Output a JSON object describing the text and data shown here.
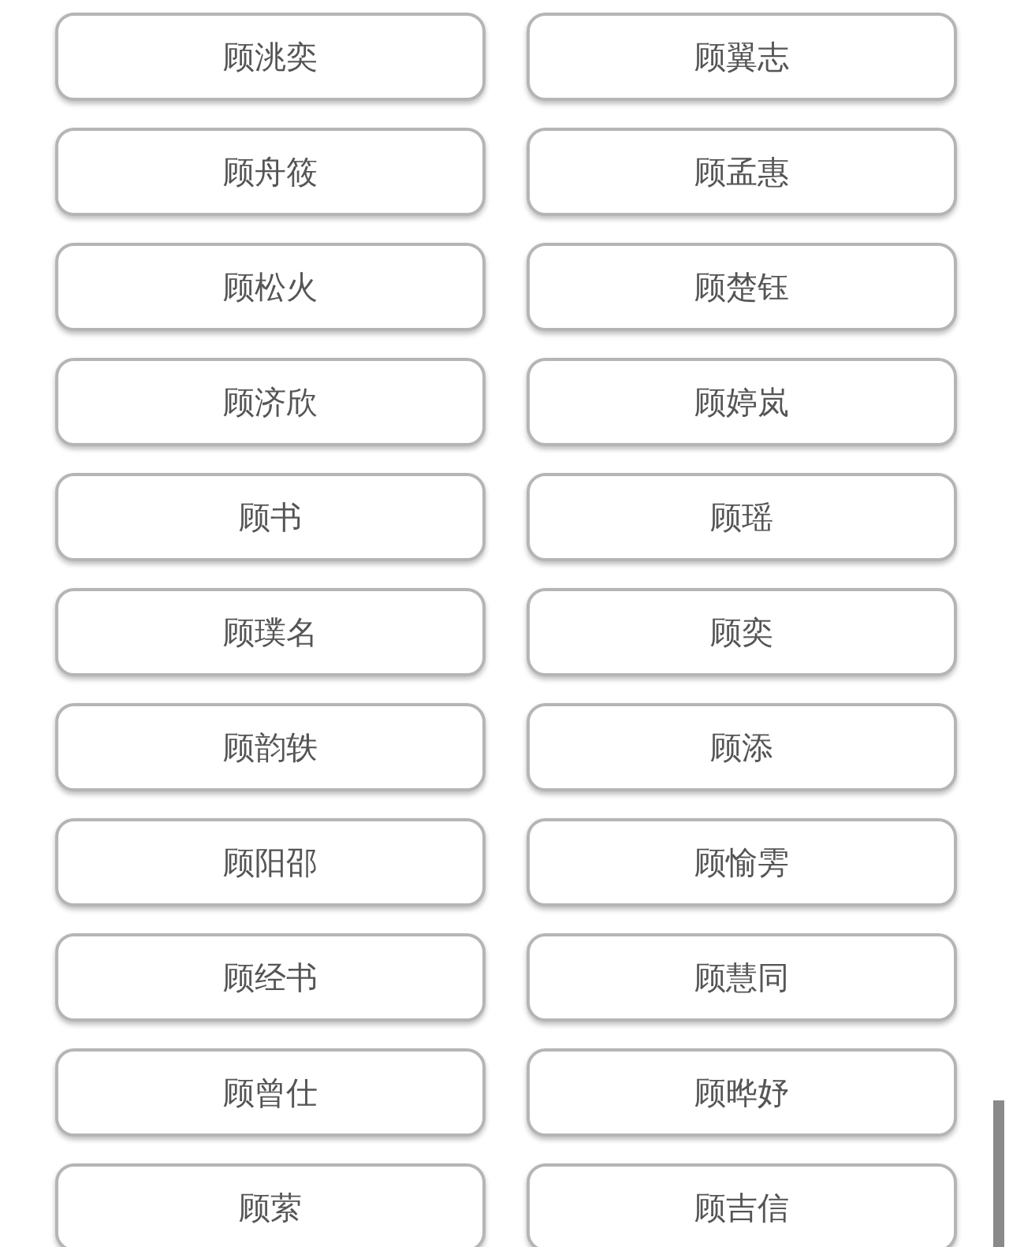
{
  "names": [
    {
      "label": "顾洮奕"
    },
    {
      "label": "顾翼志"
    },
    {
      "label": "顾舟筱"
    },
    {
      "label": "顾孟惠"
    },
    {
      "label": "顾松火"
    },
    {
      "label": "顾楚钰"
    },
    {
      "label": "顾济欣"
    },
    {
      "label": "顾婷岚"
    },
    {
      "label": "顾书"
    },
    {
      "label": "顾瑶"
    },
    {
      "label": "顾璞名"
    },
    {
      "label": "顾奕"
    },
    {
      "label": "顾韵轶"
    },
    {
      "label": "顾添"
    },
    {
      "label": "顾阳邵"
    },
    {
      "label": "顾愉雱"
    },
    {
      "label": "顾经书"
    },
    {
      "label": "顾慧同"
    },
    {
      "label": "顾曾仕"
    },
    {
      "label": "顾晔妤"
    },
    {
      "label": "顾萦"
    },
    {
      "label": "顾吉信"
    }
  ]
}
